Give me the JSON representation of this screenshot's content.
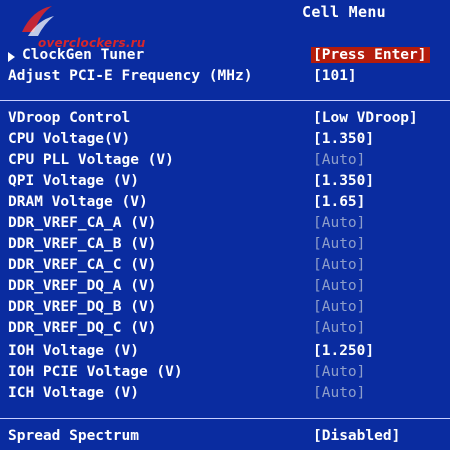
{
  "header": {
    "title": "Cell Menu",
    "watermark": "overclockers.ru"
  },
  "top_items": [
    {
      "label": "ClockGen Tuner",
      "value": "[Press Enter]",
      "submenu": true,
      "selected": true
    },
    {
      "label": "Adjust PCI-E Frequency (MHz)",
      "value": "[101]"
    }
  ],
  "voltage_items": [
    {
      "label": "VDroop Control",
      "value": "[Low VDroop]"
    },
    {
      "label": "CPU Voltage(V)",
      "value": "[1.350]"
    },
    {
      "label": "CPU PLL Voltage (V)",
      "value": "[Auto]",
      "auto": true
    },
    {
      "label": "QPI Voltage (V)",
      "value": "[1.350]"
    },
    {
      "label": "DRAM Voltage (V)",
      "value": "[1.65]"
    },
    {
      "label": "DDR_VREF_CA_A (V)",
      "value": "[Auto]",
      "auto": true
    },
    {
      "label": "DDR_VREF_CA_B (V)",
      "value": "[Auto]",
      "auto": true
    },
    {
      "label": "DDR_VREF_CA_C (V)",
      "value": "[Auto]",
      "auto": true
    },
    {
      "label": "DDR_VREF_DQ_A (V)",
      "value": "[Auto]",
      "auto": true
    },
    {
      "label": "DDR_VREF_DQ_B (V)",
      "value": "[Auto]",
      "auto": true
    },
    {
      "label": "DDR_VREF_DQ_C (V)",
      "value": "[Auto]",
      "auto": true
    },
    {
      "label": "IOH Voltage (V)",
      "value": "[1.250]"
    },
    {
      "label": "IOH PCIE Voltage (V)",
      "value": "[Auto]",
      "auto": true
    },
    {
      "label": "ICH Voltage (V)",
      "value": "[Auto]",
      "auto": true
    }
  ],
  "bottom_items": [
    {
      "label": "Spread Spectrum",
      "value": "[Disabled]"
    }
  ],
  "colors": {
    "background": "#0a2ca0",
    "text": "#ffffff",
    "auto_value": "#8f9fca",
    "selection": "#b41c0c",
    "watermark": "#d8262a"
  }
}
